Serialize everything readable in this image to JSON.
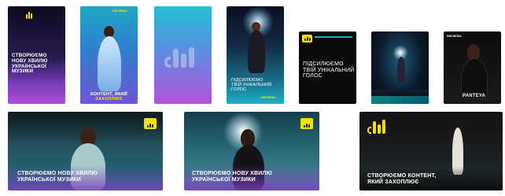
{
  "tiles": {
    "t1": {
      "line1": "Створюємо",
      "line2": "нову хвилю",
      "line3": "української",
      "line4": "музики"
    },
    "t2": {
      "tag": "DIM MEDIA",
      "line1": "Контент, який",
      "line2": "захоплює"
    },
    "t3": {},
    "t4": {
      "line1": "Підсилюємо",
      "line2": "твій унікальний",
      "line3": "голос",
      "tag": "DIM MEDIA"
    },
    "t5": {
      "line1": "Підсилюємо",
      "line2": "твій унікальний",
      "line3": "голос"
    },
    "t6": {},
    "t7": {
      "tag": "DIM MEDIA",
      "caption": "PANTEYA"
    },
    "b1": {
      "logo_text": "DIM MEDIA",
      "line1": "Створюємо нову хвилю",
      "line2": "української музики"
    },
    "b2": {
      "logo_text": "DIM MEDIA",
      "line1": "Створюємо нову хвилю",
      "line2": "української музики"
    },
    "b3": {
      "line1": "Створюємо контент,",
      "line2": "який захоплює"
    }
  },
  "colors": {
    "accent": "#f5e100",
    "purple": "#7b3fbf",
    "cyan": "#39c6d9"
  }
}
